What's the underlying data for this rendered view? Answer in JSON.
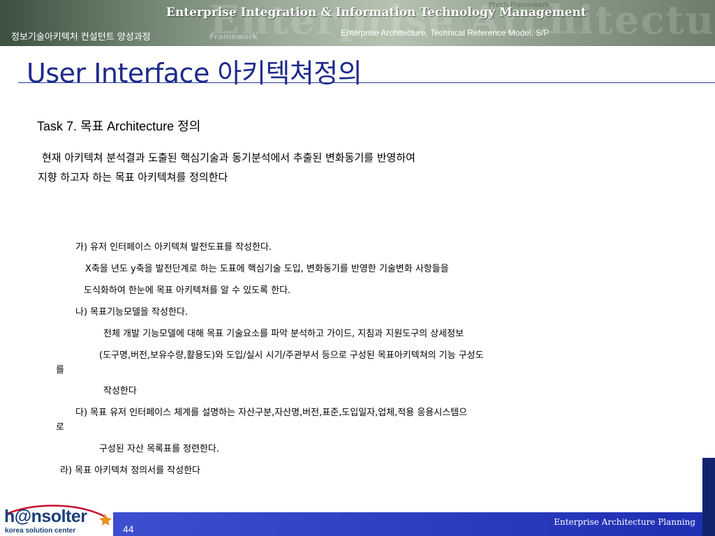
{
  "header": {
    "banner_title": "Enterprise Integration & Information Technology Management",
    "banner_watermark": "Enterprise Architecture Mod",
    "banner_watermark_small": "Framework",
    "banner_watermark_small2": "Ptech Framework",
    "course_name": "정보기술아키텍처 컨설턴트 양성과정",
    "subtitle": "Enterprise Architecture, Technical Reference Model, S/P"
  },
  "slide": {
    "title": "User Interface 아키텍쳐정의",
    "task_heading": "Task 7. 목표 Architecture 정의",
    "intro_lines": [
      "현재 아키텍쳐 분석결과 도출된 핵심기술과 동기분석에서 추출된 변화동기를 반영하여",
      "지향 하고자 하는 목표 아키텍쳐를 정의한다"
    ],
    "body_lines": [
      "가)  유저 인터페이스 아키텍쳐 발전도표를 작성한다.",
      "X축을 년도  y축을 발전단계로 하는 도표에  핵심기술 도입, 변화동기를 반영한 기술변화 사항들을",
      "도식화하여 한눈에 목표 아키텍쳐를 알 수 있도록 한다.",
      "나)  목표기능모델을 작성한다.",
      "전체 개발 기능모델에 대해 목표 기술요소를 파악 분석하고 가이드, 지침과  지원도구의 상세정보",
      "(도구명,버전,보유수량,활용도)와 도입/실시 시기/주관부서 등으로 구성된 목표아키텍쳐의 기능 구성도",
      "를",
      "작성한다",
      "다)   목표 유저 인터페이스 체계를 설명하는 자산구분,자산명,버전,표준,도입일자,업체,적용 응용시스템으",
      "로",
      "구성된 자산 목록표를 정련한다.",
      "라) 목표 아키텍쳐 정의서를 작성한다"
    ]
  },
  "footer": {
    "logo_text": "h@nsolter",
    "logo_tagline": "korea solution center",
    "page_number": "44",
    "caption": "Enterprise Architecture Planning"
  },
  "colors": {
    "title": "#1e2a8c",
    "footer_bar": "#1f2fb2",
    "accent_block": "#12236e",
    "logo_orange": "#e8911c"
  }
}
